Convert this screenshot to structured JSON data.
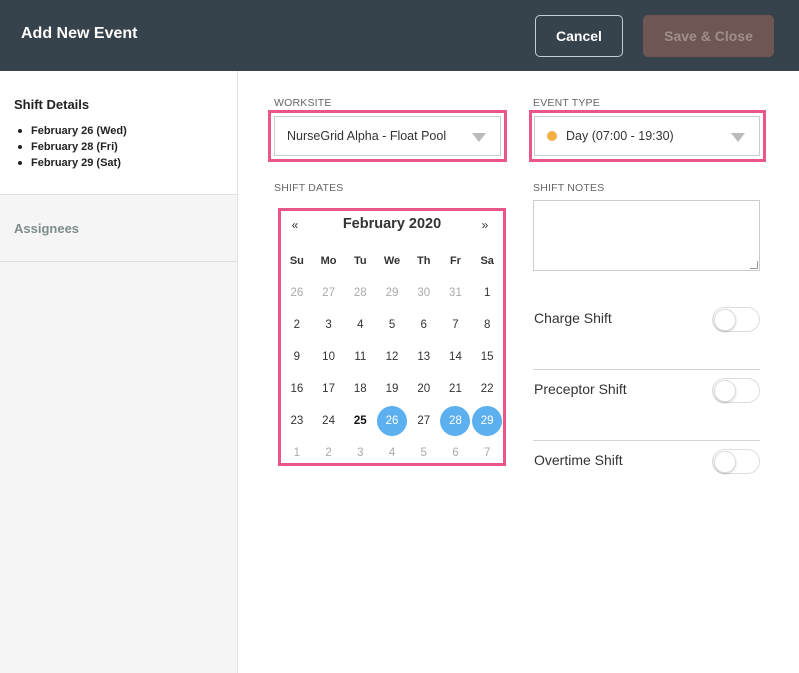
{
  "header": {
    "title": "Add New Event",
    "cancel_label": "Cancel",
    "save_label": "Save & Close"
  },
  "sidebar": {
    "shift_details_title": "Shift Details",
    "shift_dates": [
      "February 26 (Wed)",
      "February 28 (Fri)",
      "February 29 (Sat)"
    ],
    "assignees_label": "Assignees"
  },
  "worksite": {
    "label": "WORKSITE",
    "value": "NurseGrid Alpha - Float Pool"
  },
  "event_type": {
    "label": "EVENT TYPE",
    "value": "Day (07:00 - 19:30)",
    "dot_color": "#f4ae46"
  },
  "shift_dates_label": "SHIFT DATES",
  "shift_notes": {
    "label": "SHIFT NOTES",
    "value": ""
  },
  "calendar": {
    "prev": "«",
    "next": "»",
    "title": "February 2020",
    "weekdays": [
      "Su",
      "Mo",
      "Tu",
      "We",
      "Th",
      "Fr",
      "Sa"
    ],
    "weeks": [
      [
        "26",
        "27",
        "28",
        "29",
        "30",
        "31",
        "1"
      ],
      [
        "2",
        "3",
        "4",
        "5",
        "6",
        "7",
        "8"
      ],
      [
        "9",
        "10",
        "11",
        "12",
        "13",
        "14",
        "15"
      ],
      [
        "16",
        "17",
        "18",
        "19",
        "20",
        "21",
        "22"
      ],
      [
        "23",
        "24",
        "25",
        "26",
        "27",
        "28",
        "29"
      ],
      [
        "1",
        "2",
        "3",
        "4",
        "5",
        "6",
        "7"
      ]
    ],
    "today": "25",
    "selected": [
      "26",
      "28",
      "29"
    ],
    "selected_color": "#5cb0ef"
  },
  "toggles": [
    {
      "label": "Charge Shift",
      "on": false
    },
    {
      "label": "Preceptor Shift",
      "on": false
    },
    {
      "label": "Overtime Shift",
      "on": false
    }
  ]
}
